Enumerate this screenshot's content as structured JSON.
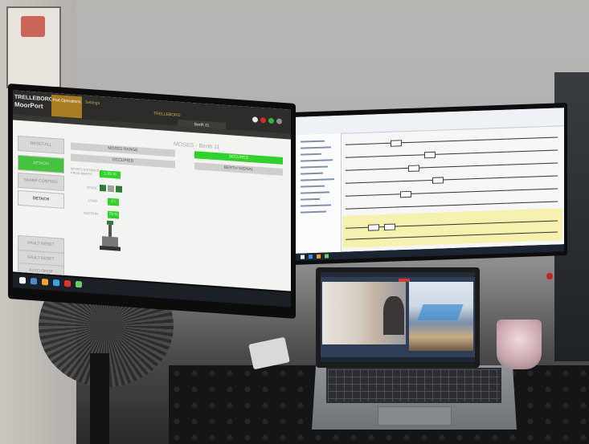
{
  "photo": {
    "description_free": true
  },
  "left_monitor": {
    "app": {
      "brand": "TRELLEBORG",
      "product": "MoorPort",
      "active_tab": "Port Operations",
      "second_tab": "Settings",
      "berth": "Berth 11",
      "center_brand": "TRELLEBORG",
      "screen_title": "MOSES - Berth 11"
    },
    "side_buttons": [
      "RESET ALL",
      "ATTACH",
      "SHARP CONTROL",
      "DETACH",
      "FAULT RESET",
      "FAULT RESET",
      "AUTO DROP"
    ],
    "fields": {
      "moses_range": "MOSES RANGE",
      "occupied": "OCCUPIED",
      "status_top": "SECURED",
      "status_bottom": "BERTH SIGNAL",
      "distance_value": "1.05 m",
      "load_value": "0 t",
      "suction_value": "75 %"
    },
    "labels": {
      "moses_distance": "MOSES DISTANCE FROM BERTH",
      "state": "STATE",
      "load": "LOAD",
      "suction": "SUCTION"
    }
  },
  "right_monitor": {
    "app": "Ladder logic editor"
  },
  "laptop": {
    "app": "Video conference",
    "record_button": "REC"
  },
  "colors": {
    "green": "#2fd12d",
    "gold_tab": "#a87d22",
    "rung_highlight": "#f7f1b0"
  }
}
